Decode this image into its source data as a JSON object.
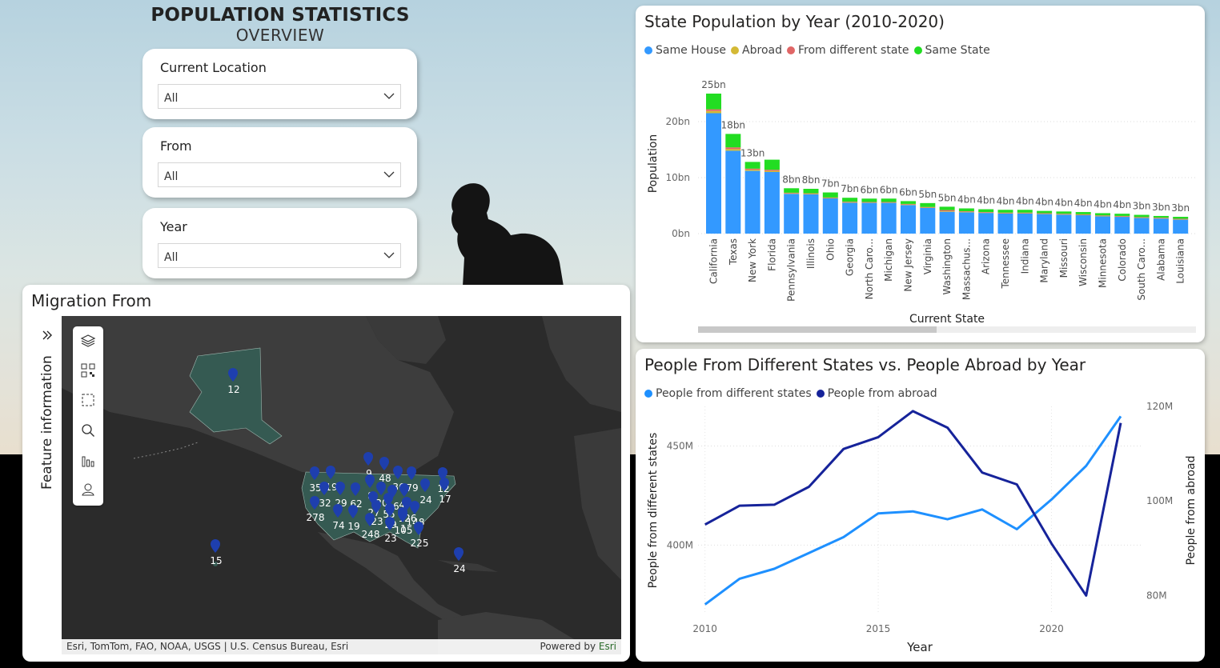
{
  "header": {
    "title": "POPULATION STATISTICS",
    "subtitle": "OVERVIEW"
  },
  "slicers": [
    {
      "label": "Current Location",
      "value": "All"
    },
    {
      "label": "From",
      "value": "All"
    },
    {
      "label": "Year",
      "value": "All"
    }
  ],
  "map": {
    "title": "Migration From",
    "side_panel_label": "Feature information",
    "expand_icon": "double-chevron-right-icon",
    "toolbar_icons": [
      "layers-icon",
      "qr-code-icon",
      "selection-box-icon",
      "search-icon",
      "bar-chart-icon",
      "user-icon"
    ],
    "markers": [
      "12",
      "35",
      "19",
      "9",
      "48",
      "36",
      "79",
      "12",
      "32",
      "29",
      "62",
      "8",
      "20",
      "16",
      "47",
      "27",
      "55",
      "126",
      "24",
      "278",
      "74",
      "19",
      "23",
      "29",
      "1",
      "148",
      "248",
      "23",
      "105",
      "225",
      "15",
      "24",
      "17"
    ],
    "attribution_left": "Esri, TomTom, FAO, NOAA, USGS | U.S. Census Bureau, Esri",
    "attribution_right_prefix": "Powered by ",
    "attribution_right_link": "Esri",
    "colors": {
      "land_highlight": "#355a52",
      "marker": "#1e3fae",
      "sea": "#2b2b2b"
    }
  },
  "chart_data": [
    {
      "type": "bar",
      "title": "State Population by Year (2010-2020)",
      "xlabel": "Current State",
      "ylabel": "Population",
      "ylim": [
        0,
        25
      ],
      "y_ticks": [
        "0bn",
        "10bn",
        "20bn"
      ],
      "grid": true,
      "legend_position": "top-left",
      "stacked": true,
      "categories": [
        "California",
        "Texas",
        "New York",
        "Florida",
        "Pennsylvania",
        "Illinois",
        "Ohio",
        "Georgia",
        "North Caro...",
        "Michigan",
        "New Jersey",
        "Virginia",
        "Washington",
        "Massachus...",
        "Arizona",
        "Tennessee",
        "Indiana",
        "Maryland",
        "Missouri",
        "Wisconsin",
        "Minnesota",
        "Colorado",
        "South Caro...",
        "Alabama",
        "Louisiana"
      ],
      "total_labels": [
        "25bn",
        "18bn",
        "13bn",
        "",
        "8bn",
        "8bn",
        "7bn",
        "7bn",
        "6bn",
        "6bn",
        "6bn",
        "5bn",
        "5bn",
        "4bn",
        "4bn",
        "4bn",
        "4bn",
        "4bn",
        "4bn",
        "4bn",
        "4bn",
        "4bn",
        "3bn",
        "3bn",
        "3bn"
      ],
      "series": [
        {
          "name": "Same House",
          "color": "#3399ff",
          "values": [
            21.5,
            14.8,
            11.2,
            11.0,
            7.1,
            7.0,
            6.3,
            5.5,
            5.5,
            5.5,
            5.1,
            4.6,
            3.9,
            3.8,
            3.7,
            3.6,
            3.6,
            3.5,
            3.4,
            3.3,
            3.1,
            3.0,
            2.8,
            2.7,
            2.5
          ]
        },
        {
          "name": "Abroad",
          "color": "#d4b935",
          "values": [
            0.4,
            0.3,
            0.2,
            0.2,
            0.1,
            0.1,
            0.05,
            0.1,
            0.05,
            0.05,
            0.1,
            0.05,
            0.1,
            0.1,
            0.05,
            0.05,
            0.05,
            0.05,
            0.05,
            0.05,
            0.05,
            0.05,
            0.05,
            0.05,
            0.05
          ]
        },
        {
          "name": "From different state",
          "color": "#e06666",
          "values": [
            0.3,
            0.3,
            0.2,
            0.2,
            0.1,
            0.1,
            0.1,
            0.1,
            0.1,
            0.1,
            0.1,
            0.1,
            0.2,
            0.1,
            0.1,
            0.1,
            0.1,
            0.1,
            0.1,
            0.1,
            0.1,
            0.1,
            0.1,
            0.1,
            0.1
          ]
        },
        {
          "name": "Same State",
          "color": "#22dd22",
          "values": [
            2.8,
            2.4,
            1.2,
            1.8,
            0.8,
            0.8,
            0.9,
            0.7,
            0.6,
            0.6,
            0.5,
            0.7,
            0.6,
            0.5,
            0.5,
            0.5,
            0.5,
            0.4,
            0.4,
            0.4,
            0.4,
            0.4,
            0.4,
            0.3,
            0.35
          ]
        }
      ]
    },
    {
      "type": "line",
      "title": "People From Different States vs. People Abroad by Year",
      "xlabel": "Year",
      "ylabel": "People from different states",
      "y2label": "People from abroad",
      "x_ticks": [
        "2010",
        "2015",
        "2020"
      ],
      "y_ticks": [
        "400M",
        "450M"
      ],
      "y2_ticks": [
        "80M",
        "100M",
        "120M"
      ],
      "ylim": [
        365,
        470
      ],
      "y2lim": [
        76,
        120
      ],
      "grid": true,
      "legend_position": "top-left",
      "x": [
        2010,
        2011,
        2012,
        2013,
        2014,
        2015,
        2016,
        2017,
        2018,
        2019,
        2020,
        2021,
        2022
      ],
      "series": [
        {
          "name": "People from different states",
          "color": "#1e90ff",
          "axis": "left",
          "values": [
            370,
            383,
            388,
            396,
            404,
            416,
            417,
            413,
            418,
            408,
            423,
            440,
            465
          ]
        },
        {
          "name": "People from abroad",
          "color": "#16239a",
          "axis": "right",
          "values": [
            95,
            99,
            99.2,
            103,
            111,
            113.5,
            119,
            115.5,
            106,
            103.5,
            91,
            80,
            116.5
          ]
        }
      ]
    }
  ]
}
